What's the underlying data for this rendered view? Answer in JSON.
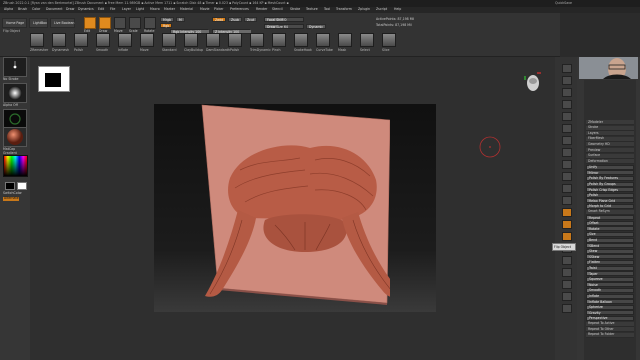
{
  "window": {
    "title": "ZBrush 2022.0.1 [Ryan van den Berkmortel]   ZBrush Document   ▪ Free Mem 11.989GB ▪ Active Mem 1711 ▪ Scratch Disk 48 ▪ Timer ▪ 0.023 ▪ PolyCount ▪ 164 KP ▪ MeshCount ▪",
    "right_status": "QuickSave"
  },
  "menubar": {
    "items": [
      "Alpha",
      "Brush",
      "Color",
      "Document",
      "Draw",
      "Dynamics",
      "Edit",
      "File",
      "Layer",
      "Light",
      "Macro",
      "Marker",
      "Material",
      "Movie",
      "Picker",
      "Preferences",
      "Render",
      "Stencil",
      "Stroke",
      "Texture",
      "Tool",
      "Transform",
      "Zplugin",
      "Zscript",
      "Help"
    ]
  },
  "topshelf": {
    "home_page": "Home Page",
    "lightbox": "LightBox",
    "live_boolean": "Live Boolean",
    "flip_object": "Flip Object",
    "modes": [
      {
        "label": "Edit",
        "active": true
      },
      {
        "label": "Draw",
        "active": true
      },
      {
        "label": "Move",
        "active": false
      },
      {
        "label": "Scale",
        "active": false
      },
      {
        "label": "Rotate",
        "active": false
      }
    ],
    "mrgb": "Mrgb",
    "rgb": "Rgb",
    "m": "M",
    "zadd": "Zadd",
    "zsub": "Zsub",
    "zcut": "Zcut",
    "rgb_intensity": "Rgb Intensity 100",
    "z_intensity": "Z Intensity 100",
    "focal_shift": "Focal Shift 0",
    "draw_size": "Draw Size 64",
    "dynamic": "Dynamic",
    "active_points": "ActivePoints: 87,198 Mil",
    "total_points": "TotalPoints: 87,198 Mil",
    "tool_icons": [
      "ZRemesher",
      "Dynamesh",
      "Polish",
      "Smooth",
      "Inflate",
      "Move",
      "Standard",
      "ClayBuildup",
      "DamStandard",
      "hPolish",
      "TrimDynamic",
      "Pinch",
      "SnakeHook",
      "CurveTube",
      "Mask",
      "Select",
      "Slice"
    ]
  },
  "leftpanel": {
    "label_top": "No Stroke",
    "label_mid": "Alpha Off",
    "label_tex": "Texture Off",
    "label_mat": "MatCap",
    "gradient": "Gradient",
    "switch_color": "SwitchColor",
    "alternate": "Alternate"
  },
  "subtool": {
    "header_items": [
      "SnapShot3D",
      "PolyFrame",
      "Floor",
      "Solo",
      "Xpose"
    ],
    "items": [
      {
        "label": "ZModeler",
        "kind": "item"
      },
      {
        "label": "Stroke",
        "kind": "item"
      },
      {
        "label": "Layers",
        "kind": "item"
      },
      {
        "label": "FiberMesh",
        "kind": "item"
      },
      {
        "label": "Geometry HD",
        "kind": "item"
      },
      {
        "label": "Preview",
        "kind": "item"
      },
      {
        "label": "Surface",
        "kind": "item"
      },
      {
        "label": "Deformation",
        "kind": "item"
      },
      {
        "label": "Unify",
        "kind": "slider",
        "level": 0
      },
      {
        "label": "Mirror",
        "kind": "slider",
        "level": 0
      },
      {
        "label": "Polish By Features",
        "kind": "slider",
        "level": 10
      },
      {
        "label": "Polish By Groups",
        "kind": "slider",
        "level": 10
      },
      {
        "label": "Polish Crisp Edges",
        "kind": "slider",
        "level": 10
      },
      {
        "label": "Polish",
        "kind": "slider",
        "level": 10
      },
      {
        "label": "Relax Plane Grid",
        "kind": "slider",
        "level": 10
      },
      {
        "label": "Morph to Grid",
        "kind": "slider",
        "level": 10
      },
      {
        "label": "Smart ReSym",
        "kind": "item"
      },
      {
        "label": "Repeat",
        "kind": "slider",
        "level": 10
      },
      {
        "label": "Offset",
        "kind": "slider",
        "level": 10
      },
      {
        "label": "Rotate",
        "kind": "slider",
        "level": 10
      },
      {
        "label": "Size",
        "kind": "slider",
        "level": 10
      },
      {
        "label": "Bend",
        "kind": "slider",
        "level": 10
      },
      {
        "label": "SBend",
        "kind": "slider",
        "level": 10
      },
      {
        "label": "Skew",
        "kind": "slider",
        "level": 10
      },
      {
        "label": "SSkew",
        "kind": "slider",
        "level": 10
      },
      {
        "label": "Flatten",
        "kind": "slider",
        "level": 10
      },
      {
        "label": "Twist",
        "kind": "slider",
        "level": 10
      },
      {
        "label": "Taper",
        "kind": "slider",
        "level": 10
      },
      {
        "label": "Squeeze",
        "kind": "slider",
        "level": 10
      },
      {
        "label": "Noise",
        "kind": "slider",
        "level": 10
      },
      {
        "label": "Smooth",
        "kind": "slider",
        "level": 10
      },
      {
        "label": "Inflate",
        "kind": "slider",
        "level": 10
      },
      {
        "label": "Inflate Balloon",
        "kind": "slider",
        "level": 10
      },
      {
        "label": "Spherize",
        "kind": "slider",
        "level": 10
      },
      {
        "label": "Gravity",
        "kind": "slider",
        "level": 10
      },
      {
        "label": "Perspective",
        "kind": "slider",
        "level": 10
      },
      {
        "label": "Repeat To Active",
        "kind": "item"
      },
      {
        "label": "Repeat To Other",
        "kind": "item"
      },
      {
        "label": "Repeat To Folder",
        "kind": "item"
      }
    ]
  },
  "tooltip": "Flip Object",
  "viewport": {
    "sculpt": "mustache on plane",
    "background_color": "#2f2f2f",
    "plane_color": "#cf8a7c",
    "hair_color": "#b55a44"
  }
}
